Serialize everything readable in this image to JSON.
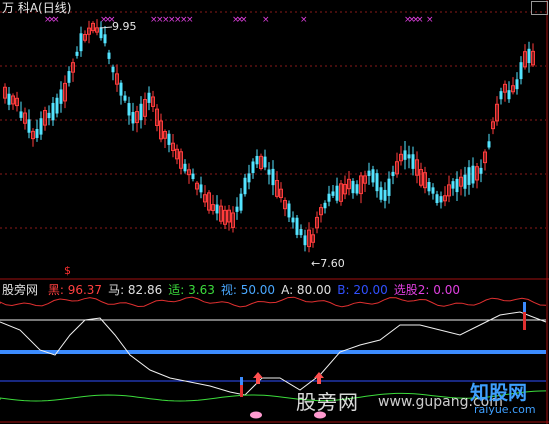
{
  "chart_title": "万  科A(日线)",
  "price_panel": {
    "high_label": "9.95",
    "low_label": "←7.60",
    "arrow_marker": "$"
  },
  "indicator_row": {
    "name": "股旁网",
    "items": [
      {
        "label": "黑:",
        "value": "96.37",
        "color": "#ff4040"
      },
      {
        "label": "马:",
        "value": "82.86",
        "color": "#e0e0e0"
      },
      {
        "label": "适:",
        "value": "3.63",
        "color": "#3cdc3c"
      },
      {
        "label": "视:",
        "value": "50.00",
        "color": "#4aa8ff"
      },
      {
        "label": "A:",
        "value": "80.00",
        "color": "#e0e0e0"
      },
      {
        "label": "B:",
        "value": "20.00",
        "color": "#3050ff"
      },
      {
        "label": "选股2:",
        "value": "0.00",
        "color": "#e040e0"
      }
    ]
  },
  "watermarks": {
    "cn1": "股旁网",
    "url": "www.gupang.com",
    "cn2": "知股网",
    "url2": "raiyue.com"
  },
  "colors": {
    "up": "#ff3c3c",
    "down": "#54e4ff",
    "grid": "#8a1a1a",
    "white_line": "#f0f0f0",
    "blue_thick": "#3c8cff"
  }
}
